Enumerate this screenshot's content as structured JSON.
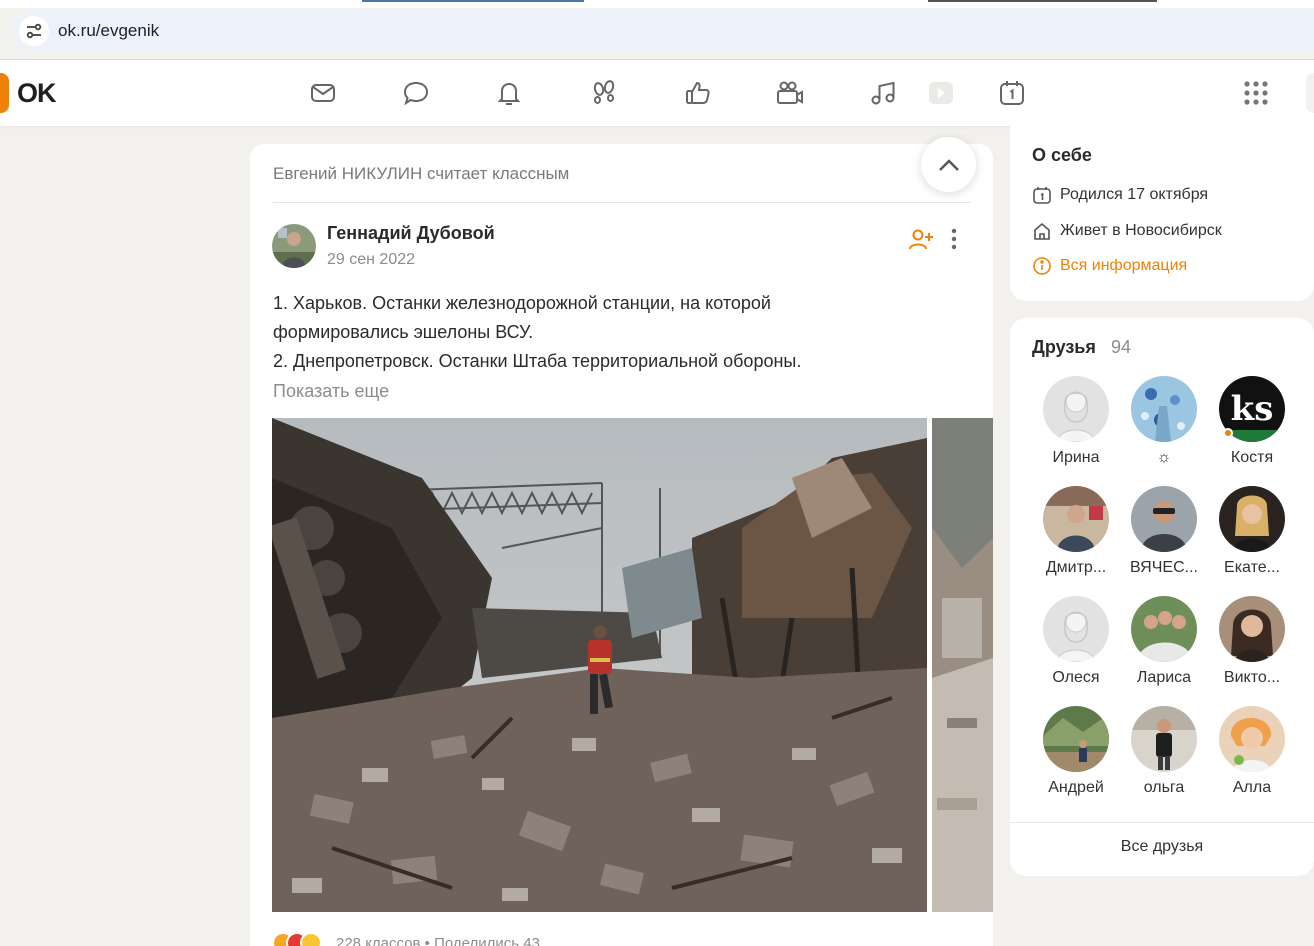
{
  "browser": {
    "url": "ok.ru/evgenik"
  },
  "header": {
    "logo_text": "OK",
    "nav_icons": [
      "mail-icon",
      "chat-icon",
      "bell-icon",
      "footprints-icon",
      "like-icon",
      "video-camera-icon",
      "music-icon",
      "play-icon",
      "calendar-icon"
    ],
    "menu_icon": "apps-grid-icon"
  },
  "feed": {
    "liked_line": "Евгений НИКУЛИН считает классным",
    "author_name": "Геннадий Дубовой",
    "post_date": "29 сен 2022",
    "post_lines": [
      "1.  Харьков. Останки железнодорожной станции, на которой",
      "формировались эшелоны ВСУ.",
      "2.  Днепропетровск. Останки Штаба территориальной обороны."
    ],
    "show_more": "Показать еще",
    "reactions_text": "228 классов   •   Поделились 43"
  },
  "about": {
    "title": "О себе",
    "birthday": "Родился 17 октября",
    "city": "Живет в Новосибирск",
    "all_info": "Вся информация"
  },
  "friends": {
    "title": "Друзья",
    "count": "94",
    "list": [
      {
        "name": "Ирина"
      },
      {
        "name": "☼"
      },
      {
        "name": "Костя"
      },
      {
        "name": "Дмитр..."
      },
      {
        "name": "ВЯЧЕС..."
      },
      {
        "name": "Екате..."
      },
      {
        "name": "Олеся"
      },
      {
        "name": "Лариса"
      },
      {
        "name": "Викто..."
      },
      {
        "name": "Андрей"
      },
      {
        "name": "ольга"
      },
      {
        "name": "Алла"
      }
    ],
    "all_friends": "Все друзья",
    "kosty_avatar_text": "ks"
  },
  "colors": {
    "accent": "#ee8208",
    "background": "#f3f1ee"
  }
}
